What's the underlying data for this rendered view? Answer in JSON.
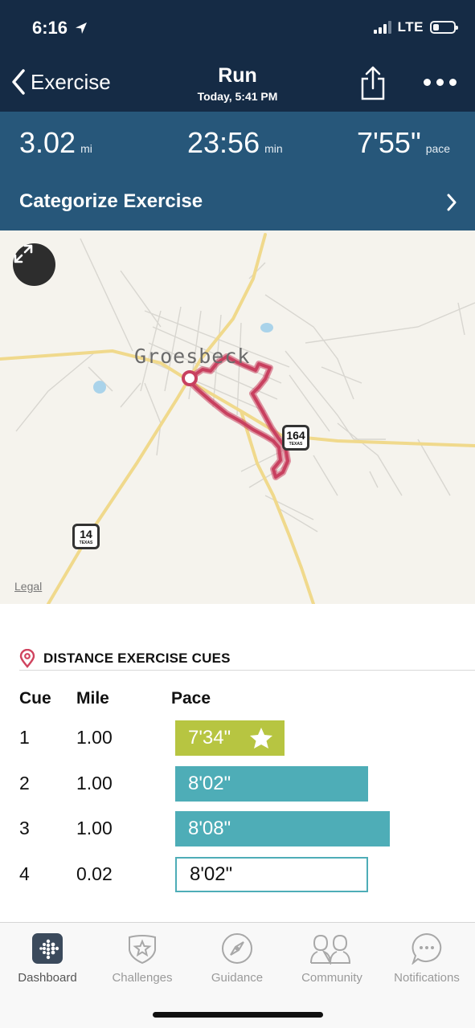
{
  "status_bar": {
    "time": "6:16",
    "network": "LTE",
    "icons": [
      "location-arrow-icon",
      "signal-icon",
      "battery-icon"
    ]
  },
  "header": {
    "back_label": "Exercise",
    "title": "Run",
    "subtitle": "Today, 5:41 PM",
    "icons": [
      "chevron-left-icon",
      "share-icon",
      "more-icon"
    ]
  },
  "stats": {
    "distance": {
      "value": "3.02",
      "unit": "mi"
    },
    "duration": {
      "value": "23:56",
      "unit": "min"
    },
    "pace": {
      "value": "7'55\"",
      "unit": "pace"
    },
    "categorize_label": "Categorize Exercise"
  },
  "map": {
    "town_label": "Groesbeck",
    "highway_markers": [
      {
        "number": "164",
        "state": "TEXAS"
      },
      {
        "number": "14",
        "state": "TEXAS"
      }
    ],
    "legal_label": "Legal",
    "colors": {
      "route": "#c8405f",
      "road_major": "#f0d98c",
      "water": "#aad3ea",
      "land": "#f5f3ed"
    }
  },
  "cues": {
    "title": "DISTANCE EXERCISE CUES",
    "columns": [
      "Cue",
      "Mile",
      "Pace"
    ],
    "rows": [
      {
        "cue": "1",
        "mile": "1.00",
        "pace": "7'34\"",
        "style": "fastest",
        "color": "#b7c541",
        "bar_fraction": 0.51
      },
      {
        "cue": "2",
        "mile": "1.00",
        "pace": "8'02\"",
        "style": "normal",
        "color": "#4eadb7",
        "bar_fraction": 0.9
      },
      {
        "cue": "3",
        "mile": "1.00",
        "pace": "8'08\"",
        "style": "normal",
        "color": "#4eadb7",
        "bar_fraction": 1.0
      },
      {
        "cue": "4",
        "mile": "0.02",
        "pace": "8'02\"",
        "style": "partial",
        "color": "#4eadb7",
        "bar_fraction": 0.9
      }
    ]
  },
  "tabbar": {
    "tabs": [
      {
        "label": "Dashboard",
        "icon": "dashboard-icon",
        "active": true
      },
      {
        "label": "Challenges",
        "icon": "challenges-icon",
        "active": false
      },
      {
        "label": "Guidance",
        "icon": "compass-icon",
        "active": false
      },
      {
        "label": "Community",
        "icon": "community-icon",
        "active": false
      },
      {
        "label": "Notifications",
        "icon": "notifications-icon",
        "active": false
      }
    ]
  },
  "colors": {
    "header_bg": "#152b45",
    "stats_bg": "#27577a"
  }
}
